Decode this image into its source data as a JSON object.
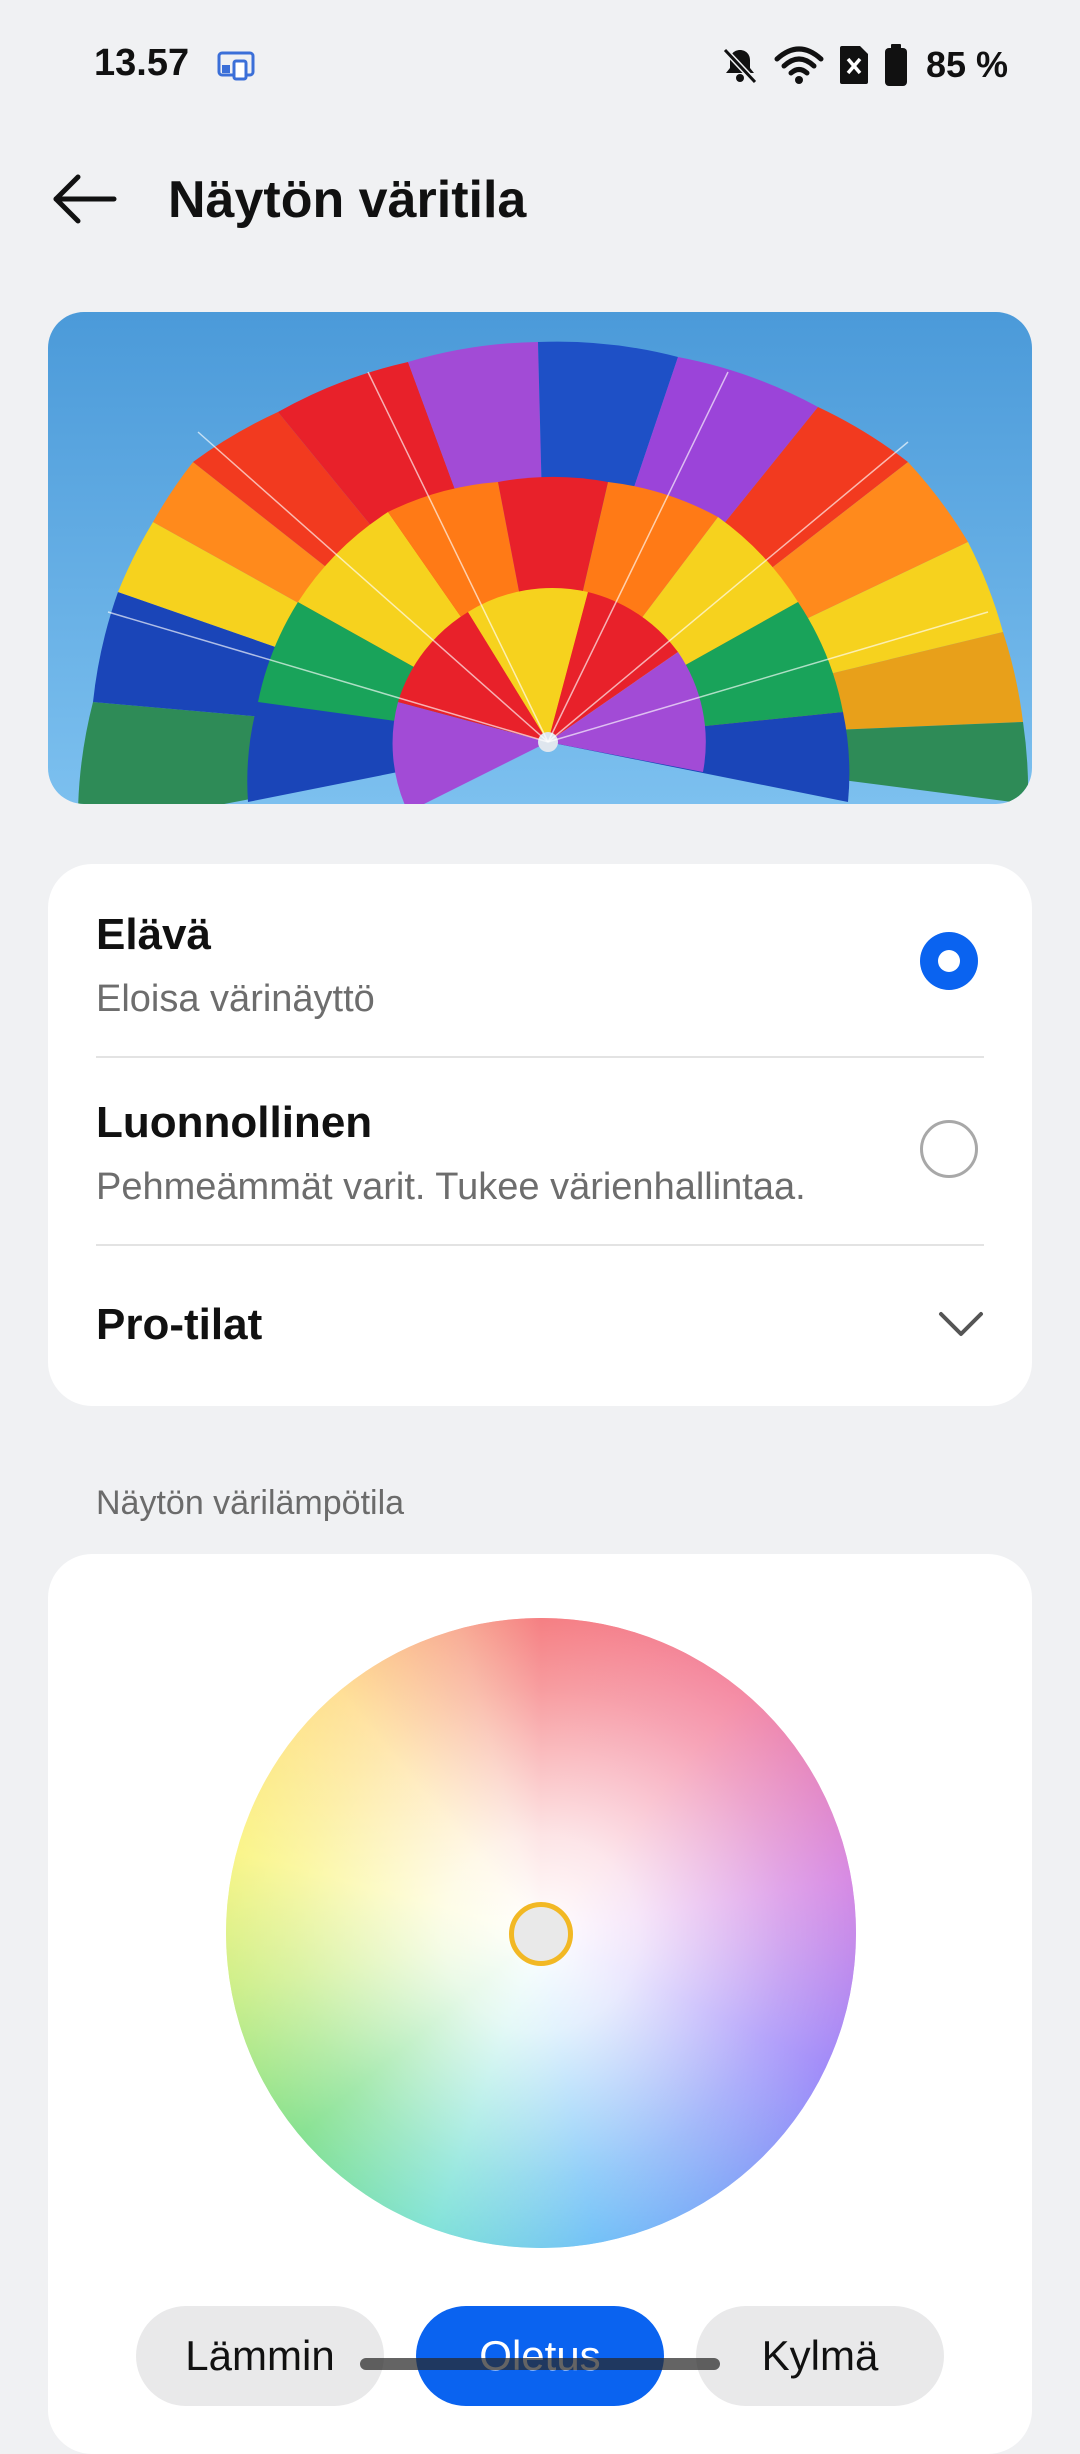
{
  "status_bar": {
    "time": "13.57",
    "battery": "85 %",
    "icons": [
      "cast-icon",
      "bell-muted-icon",
      "wifi-icon",
      "sim-off-icon",
      "battery-icon"
    ]
  },
  "header": {
    "title": "Näytön väritila",
    "back_icon": "arrow-left-icon"
  },
  "hero": {
    "image": "rainbow-parachute-photo"
  },
  "modes": {
    "selected": "vivid",
    "items": [
      {
        "id": "vivid",
        "title": "Elävä",
        "subtitle": "Eloisa värinäyttö",
        "selected": true
      },
      {
        "id": "natural",
        "title": "Luonnollinen",
        "subtitle": "Pehmeämmät varit. Tukee värienhallintaa.",
        "selected": false
      }
    ],
    "pro": {
      "title": "Pro-tilat",
      "icon": "chevron-down-icon"
    }
  },
  "temperature": {
    "section_label": "Näytön värilämpötila",
    "presets": [
      {
        "label": "Lämmin",
        "active": false
      },
      {
        "label": "Oletus",
        "active": true
      },
      {
        "label": "Kylmä",
        "active": false
      }
    ],
    "accent": "#0a63f0",
    "handle_color": "#f2b824"
  }
}
